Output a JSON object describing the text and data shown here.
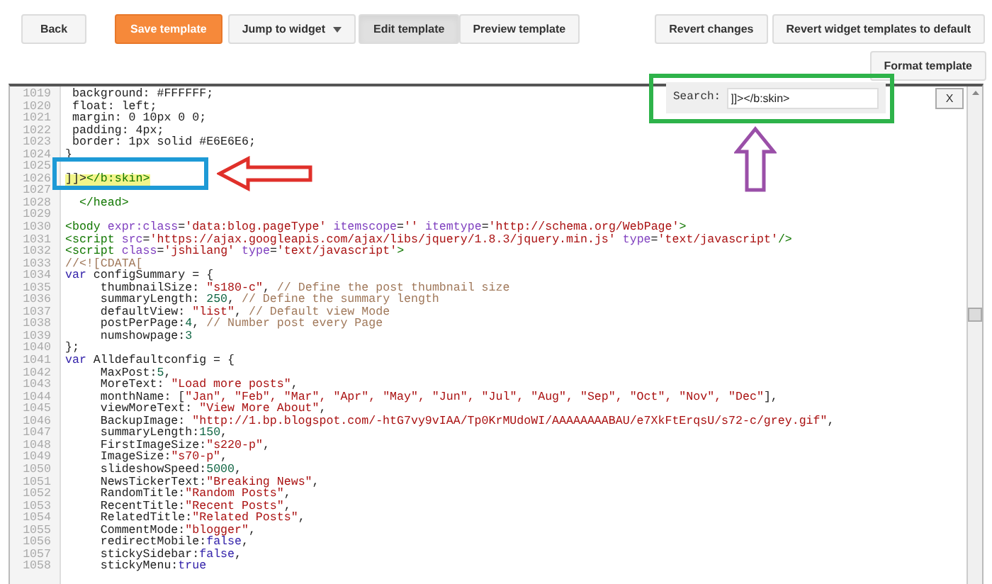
{
  "toolbar": {
    "back": "Back",
    "save": "Save template",
    "jump": {
      "label": "Jump to widget"
    },
    "view_tabs": [
      {
        "label": "Edit template",
        "selected": true
      },
      {
        "label": "Preview template",
        "selected": false
      }
    ],
    "revert": "Revert changes",
    "revert_widgets": "Revert widget templates to default",
    "format": "Format template"
  },
  "search": {
    "label": "Search:",
    "value": "]]></b:skin>",
    "close": "X"
  },
  "editor": {
    "lines": [
      {
        "number": "1019",
        "highlighted": false,
        "tokens": [
          {
            "kind": "plain",
            "text": " background: #FFFFFF;"
          }
        ]
      },
      {
        "number": "1020",
        "highlighted": false,
        "tokens": [
          {
            "kind": "plain",
            "text": " float: left;"
          }
        ]
      },
      {
        "number": "1021",
        "highlighted": false,
        "tokens": [
          {
            "kind": "plain",
            "text": " margin: 0 10px 0 0;"
          }
        ]
      },
      {
        "number": "1022",
        "highlighted": false,
        "tokens": [
          {
            "kind": "plain",
            "text": " padding: 4px;"
          }
        ]
      },
      {
        "number": "1023",
        "highlighted": false,
        "tokens": [
          {
            "kind": "plain",
            "text": " border: 1px solid #E6E6E6;"
          }
        ]
      },
      {
        "number": "1024",
        "highlighted": false,
        "tokens": [
          {
            "kind": "plain",
            "text": "}"
          }
        ]
      },
      {
        "number": "1025",
        "highlighted": false
      },
      {
        "number": "1026",
        "highlighted": true,
        "tokens": [
          {
            "kind": "plain",
            "text": "]]>"
          },
          {
            "kind": "tag",
            "text": "</b:skin>"
          }
        ]
      },
      {
        "number": "1027",
        "highlighted": false
      },
      {
        "number": "1028",
        "highlighted": false,
        "tokens": [
          {
            "kind": "tag",
            "text": "  </head>"
          }
        ]
      },
      {
        "number": "1029",
        "highlighted": false
      },
      {
        "number": "1030",
        "highlighted": false,
        "tokens": [
          {
            "kind": "tag",
            "text": "<body "
          },
          {
            "kind": "attr",
            "text": "expr:class"
          },
          {
            "kind": "plain",
            "text": "="
          },
          {
            "kind": "string",
            "text": "'data:blog.pageType'"
          },
          {
            "kind": "attr",
            "text": " itemscope"
          },
          {
            "kind": "plain",
            "text": "="
          },
          {
            "kind": "string",
            "text": "''"
          },
          {
            "kind": "attr",
            "text": " itemtype"
          },
          {
            "kind": "plain",
            "text": "="
          },
          {
            "kind": "string",
            "text": "'http://schema.org/WebPage'"
          },
          {
            "kind": "tag",
            "text": ">"
          }
        ]
      },
      {
        "number": "1031",
        "highlighted": false,
        "tokens": [
          {
            "kind": "tag",
            "text": "<script "
          },
          {
            "kind": "attr",
            "text": "src"
          },
          {
            "kind": "plain",
            "text": "="
          },
          {
            "kind": "string",
            "text": "'https://ajax.googleapis.com/ajax/libs/jquery/1.8.3/jquery.min.js'"
          },
          {
            "kind": "attr",
            "text": " type"
          },
          {
            "kind": "plain",
            "text": "="
          },
          {
            "kind": "string",
            "text": "'text/javascript'"
          },
          {
            "kind": "tag",
            "text": "/>"
          }
        ]
      },
      {
        "number": "1032",
        "highlighted": false,
        "tokens": [
          {
            "kind": "tag",
            "text": "<script "
          },
          {
            "kind": "attr",
            "text": "class"
          },
          {
            "kind": "plain",
            "text": "="
          },
          {
            "kind": "string",
            "text": "'jshilang'"
          },
          {
            "kind": "attr",
            "text": " type"
          },
          {
            "kind": "plain",
            "text": "="
          },
          {
            "kind": "string",
            "text": "'text/javascript'"
          },
          {
            "kind": "tag",
            "text": ">"
          }
        ]
      },
      {
        "number": "1033",
        "highlighted": false,
        "tokens": [
          {
            "kind": "comment",
            "text": "//<![CDATA["
          }
        ]
      },
      {
        "number": "1034",
        "highlighted": false,
        "tokens": [
          {
            "kind": "keyword",
            "text": "var"
          },
          {
            "kind": "plain",
            "text": " configSummary = {"
          }
        ]
      },
      {
        "number": "1035",
        "highlighted": false,
        "tokens": [
          {
            "kind": "plain",
            "text": "     thumbnailSize: "
          },
          {
            "kind": "string",
            "text": "\"s180-c\""
          },
          {
            "kind": "plain",
            "text": ", "
          },
          {
            "kind": "comment",
            "text": "// Define the post thumbnail size"
          }
        ]
      },
      {
        "number": "1036",
        "highlighted": false,
        "tokens": [
          {
            "kind": "plain",
            "text": "     summaryLength: "
          },
          {
            "kind": "number",
            "text": "250"
          },
          {
            "kind": "plain",
            "text": ", "
          },
          {
            "kind": "comment",
            "text": "// Define the summary length"
          }
        ]
      },
      {
        "number": "1037",
        "highlighted": false,
        "tokens": [
          {
            "kind": "plain",
            "text": "     defaultView: "
          },
          {
            "kind": "string",
            "text": "\"list\""
          },
          {
            "kind": "plain",
            "text": ", "
          },
          {
            "kind": "comment",
            "text": "// Default view Mode"
          }
        ]
      },
      {
        "number": "1038",
        "highlighted": false,
        "tokens": [
          {
            "kind": "plain",
            "text": "     postPerPage:"
          },
          {
            "kind": "number",
            "text": "4"
          },
          {
            "kind": "plain",
            "text": ", "
          },
          {
            "kind": "comment",
            "text": "// Number post every Page"
          }
        ]
      },
      {
        "number": "1039",
        "highlighted": false,
        "tokens": [
          {
            "kind": "plain",
            "text": "     numshowpage:"
          },
          {
            "kind": "number",
            "text": "3"
          }
        ]
      },
      {
        "number": "1040",
        "highlighted": false,
        "tokens": [
          {
            "kind": "plain",
            "text": "};"
          }
        ]
      },
      {
        "number": "1041",
        "highlighted": false,
        "tokens": [
          {
            "kind": "keyword",
            "text": "var"
          },
          {
            "kind": "plain",
            "text": " Alldefaultconfig = {"
          }
        ]
      },
      {
        "number": "1042",
        "highlighted": false,
        "tokens": [
          {
            "kind": "plain",
            "text": "     MaxPost:"
          },
          {
            "kind": "number",
            "text": "5"
          },
          {
            "kind": "plain",
            "text": ","
          }
        ]
      },
      {
        "number": "1043",
        "highlighted": false,
        "tokens": [
          {
            "kind": "plain",
            "text": "     MoreText: "
          },
          {
            "kind": "string",
            "text": "\"Load more posts\""
          },
          {
            "kind": "plain",
            "text": ","
          }
        ]
      },
      {
        "number": "1044",
        "highlighted": false,
        "tokens": [
          {
            "kind": "plain",
            "text": "     monthName: ["
          },
          {
            "kind": "string",
            "text": "\"Jan\", \"Feb\", \"Mar\", \"Apr\", \"May\", \"Jun\", \"Jul\", \"Aug\", \"Sep\", \"Oct\", \"Nov\", \"Dec\""
          },
          {
            "kind": "plain",
            "text": "],"
          }
        ]
      },
      {
        "number": "1045",
        "highlighted": false,
        "tokens": [
          {
            "kind": "plain",
            "text": "     viewMoreText: "
          },
          {
            "kind": "string",
            "text": "\"View More About\""
          },
          {
            "kind": "plain",
            "text": ","
          }
        ]
      },
      {
        "number": "1046",
        "highlighted": false,
        "tokens": [
          {
            "kind": "plain",
            "text": "     BackupImage: "
          },
          {
            "kind": "string",
            "text": "\"http://1.bp.blogspot.com/-htG7vy9vIAA/Tp0KrMUdoWI/AAAAAAAABAU/e7XkFtErqsU/s72-c/grey.gif\""
          },
          {
            "kind": "plain",
            "text": ","
          }
        ]
      },
      {
        "number": "1047",
        "highlighted": false,
        "tokens": [
          {
            "kind": "plain",
            "text": "     summaryLength:"
          },
          {
            "kind": "number",
            "text": "150"
          },
          {
            "kind": "plain",
            "text": ","
          }
        ]
      },
      {
        "number": "1048",
        "highlighted": false,
        "tokens": [
          {
            "kind": "plain",
            "text": "     FirstImageSize:"
          },
          {
            "kind": "string",
            "text": "\"s220-p\""
          },
          {
            "kind": "plain",
            "text": ","
          }
        ]
      },
      {
        "number": "1049",
        "highlighted": false,
        "tokens": [
          {
            "kind": "plain",
            "text": "     ImageSize:"
          },
          {
            "kind": "string",
            "text": "\"s70-p\""
          },
          {
            "kind": "plain",
            "text": ","
          }
        ]
      },
      {
        "number": "1050",
        "highlighted": false,
        "tokens": [
          {
            "kind": "plain",
            "text": "     slideshowSpeed:"
          },
          {
            "kind": "number",
            "text": "5000"
          },
          {
            "kind": "plain",
            "text": ","
          }
        ]
      },
      {
        "number": "1051",
        "highlighted": false,
        "tokens": [
          {
            "kind": "plain",
            "text": "     NewsTickerText:"
          },
          {
            "kind": "string",
            "text": "\"Breaking News\""
          },
          {
            "kind": "plain",
            "text": ","
          }
        ]
      },
      {
        "number": "1052",
        "highlighted": false,
        "tokens": [
          {
            "kind": "plain",
            "text": "     RandomTitle:"
          },
          {
            "kind": "string",
            "text": "\"Random Posts\""
          },
          {
            "kind": "plain",
            "text": ","
          }
        ]
      },
      {
        "number": "1053",
        "highlighted": false,
        "tokens": [
          {
            "kind": "plain",
            "text": "     RecentTitle:"
          },
          {
            "kind": "string",
            "text": "\"Recent Posts\""
          },
          {
            "kind": "plain",
            "text": ","
          }
        ]
      },
      {
        "number": "1054",
        "highlighted": false,
        "tokens": [
          {
            "kind": "plain",
            "text": "     RelatedTitle:"
          },
          {
            "kind": "string",
            "text": "\"Related Posts\""
          },
          {
            "kind": "plain",
            "text": ","
          }
        ]
      },
      {
        "number": "1055",
        "highlighted": false,
        "tokens": [
          {
            "kind": "plain",
            "text": "     CommentMode:"
          },
          {
            "kind": "string",
            "text": "\"blogger\""
          },
          {
            "kind": "plain",
            "text": ","
          }
        ]
      },
      {
        "number": "1056",
        "highlighted": false,
        "tokens": [
          {
            "kind": "plain",
            "text": "     redirectMobile:"
          },
          {
            "kind": "keyword",
            "text": "false"
          },
          {
            "kind": "plain",
            "text": ","
          }
        ]
      },
      {
        "number": "1057",
        "highlighted": false,
        "tokens": [
          {
            "kind": "plain",
            "text": "     stickySidebar:"
          },
          {
            "kind": "keyword",
            "text": "false"
          },
          {
            "kind": "plain",
            "text": ","
          }
        ]
      },
      {
        "number": "1058",
        "highlighted": false,
        "tokens": [
          {
            "kind": "plain",
            "text": "     stickyMenu:"
          },
          {
            "kind": "keyword",
            "text": "true"
          }
        ]
      }
    ]
  }
}
